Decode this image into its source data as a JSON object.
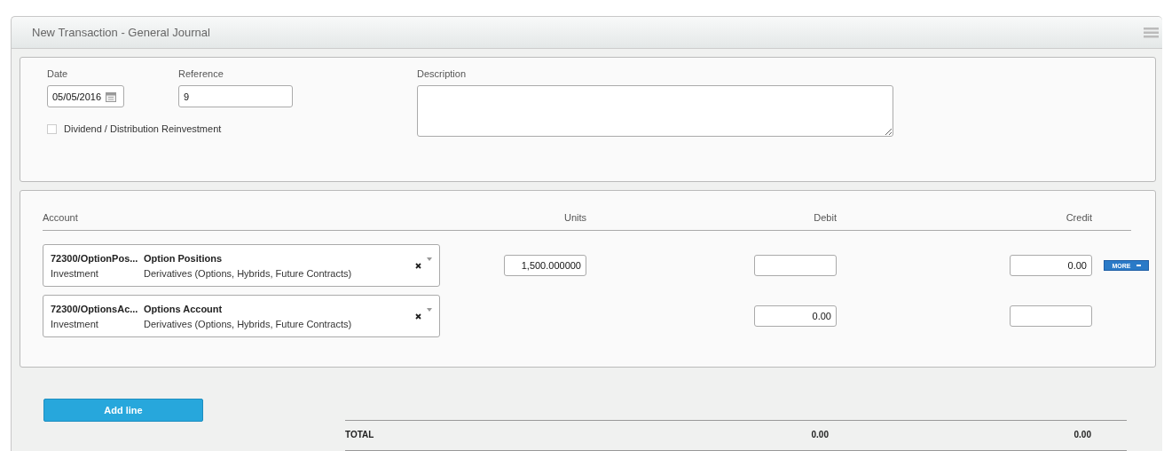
{
  "window": {
    "title": "New Transaction - General Journal"
  },
  "header": {
    "date_label": "Date",
    "date_value": "05/05/2016",
    "reference_label": "Reference",
    "reference_value": "9",
    "description_label": "Description",
    "reinvestment": {
      "label": "Dividend / Distribution Reinvestment",
      "checked": false
    }
  },
  "lines": {
    "columns": [
      "Account",
      "Units",
      "Debit",
      "Credit"
    ],
    "rows": [
      {
        "code": "72300/OptionPos...",
        "name": "Option Positions",
        "type": "Investment",
        "category": "Derivatives (Options, Hybrids, Future Contracts)",
        "units": "1,500.000000",
        "debit": "",
        "credit": "0.00",
        "more": "MORE"
      },
      {
        "code": "72300/OptionsAc...",
        "name": "Options Account",
        "type": "Investment",
        "category": "Derivatives (Options, Hybrids, Future Contracts)",
        "debit": "0.00",
        "credit": ""
      }
    ]
  },
  "add_line": "Add line",
  "totals": {
    "label": "TOTAL",
    "debit": "0.00",
    "credit": "0.00"
  }
}
